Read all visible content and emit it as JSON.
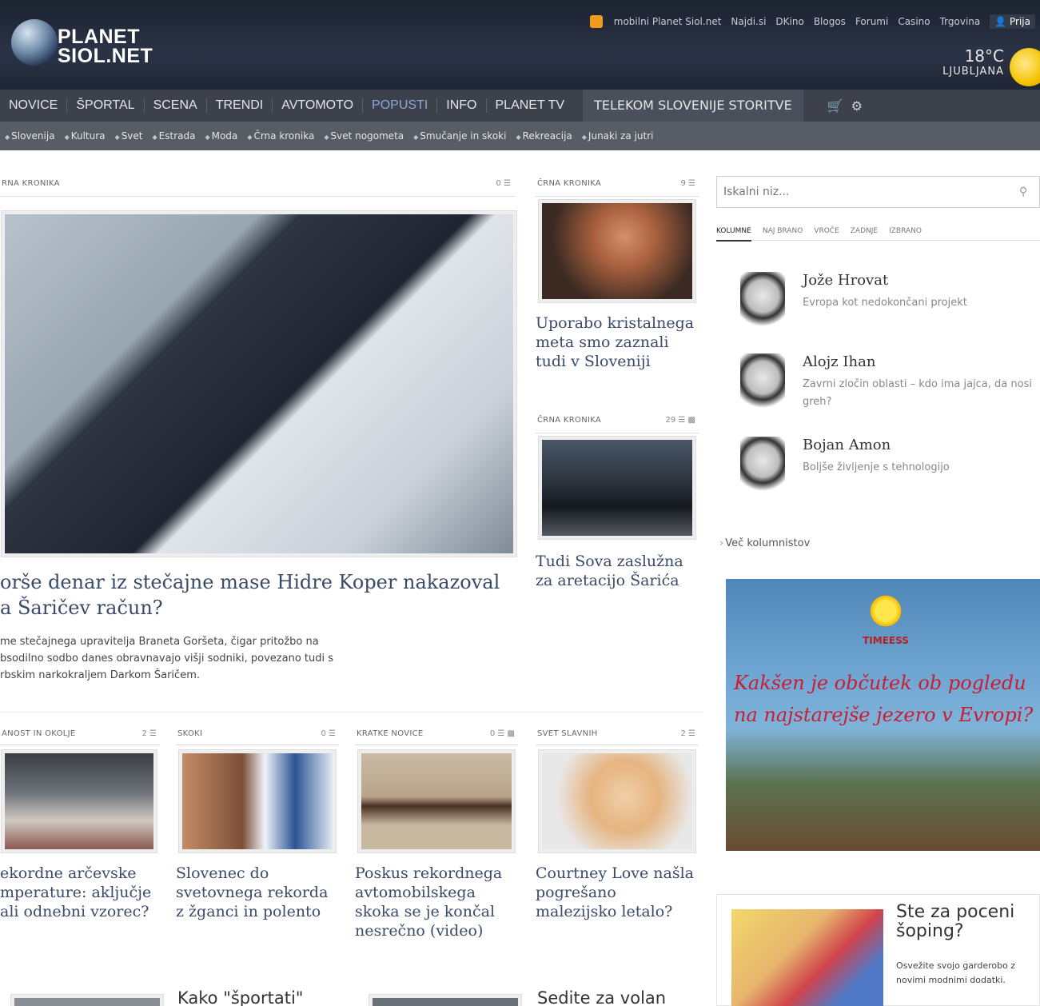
{
  "header": {
    "logo_line1": "PLANET",
    "logo_line2": "SIOL.NET",
    "top_links": [
      "mobilni Planet Siol.net",
      "Najdi.si",
      "DKino",
      "Blogos",
      "Forumi",
      "Casino",
      "Trgovina"
    ],
    "login_label": "Prija",
    "weather_temp": "18°C",
    "weather_city": "LJUBLJANA"
  },
  "nav": {
    "items": [
      "NOVICE",
      "ŠPORTAL",
      "SCENA",
      "TRENDI",
      "AVTOMOTO",
      "POPUSTI",
      "INFO",
      "PLANET TV"
    ],
    "active_index": 5,
    "telekom_label": "TELEKOM SLOVENIJE STORITVE"
  },
  "subnav": [
    "Slovenija",
    "Kultura",
    "Svet",
    "Estrada",
    "Moda",
    "Črna kronika",
    "Svet nogometa",
    "Smučanje in skoki",
    "Rekreacija",
    "Junaki za jutri"
  ],
  "lead": {
    "category": "RNA KRONIKA",
    "count": "0",
    "title_line1": "orše denar iz stečajne mase Hidre Koper nakazoval",
    "title_line2": "a Šaričev račun?",
    "summary_line1": "me stečajnega upravitelja Braneta Goršeta, čigar pritožbo na",
    "summary_line2": "bsodilno sodbo danes obravnavajo višji sodniki, povezano tudi s",
    "summary_line3": "rbskim narkokraljem Darkom Šaričem."
  },
  "side_stories": [
    {
      "category": "ČRNA KRONIKA",
      "count": "9",
      "title": "Uporabo kristalnega meta smo zaznali tudi v Sloveniji"
    },
    {
      "category": "ČRNA KRONIKA",
      "count": "29",
      "title": "Tudi Sova zaslužna za aretacijo Šarića"
    }
  ],
  "grid_stories": [
    {
      "category": "ANOST IN OKOLJE",
      "count": "2",
      "title": "ekordne arčevske mperature: aključje ali odnebni vzorec?"
    },
    {
      "category": "SKOKI",
      "count": "0",
      "title": "Slovenec do svetovnega rekorda z žganci in polento"
    },
    {
      "category": "KRATKE NOVICE",
      "count": "0",
      "title": "Poskus rekordnega avtomobilskega skoka se je končal nesrečno (video)"
    },
    {
      "category": "SVET SLAVNIH",
      "count": "2",
      "title": "Courtney Love našla pogrešano malezijsko letalo?"
    }
  ],
  "bottom_partial": {
    "left_title": "Kako \"športati\"",
    "right_title": "Sedite za volan"
  },
  "sidebar": {
    "search_placeholder": "Iskalni niz...",
    "tabs": [
      "KOLUMNE",
      "NAJ BRANO",
      "VROČE",
      "ZADNJE",
      "IZBRANO"
    ],
    "columnists": [
      {
        "name": "Jože Hrovat",
        "desc": "Evropa kot nedokončani projekt"
      },
      {
        "name": "Alojz Ihan",
        "desc": "Zavrni zločin oblasti – kdo ima jajca, da nosi greh?"
      },
      {
        "name": "Bojan Amon",
        "desc": "Boljše življenje s tehnologijo"
      }
    ],
    "more_columnists": "Več kolumnistov",
    "ad_brand": "TIMEESS",
    "ad_slogan_line1": "Kakšen je občutek ob pogledu",
    "ad_slogan_line2": "na najstarejše jezero v Evropi?",
    "promo_title": "Ste za poceni šoping?",
    "promo_text": "Osvežite svojo garderobo z novimi modnimi dodatki."
  }
}
